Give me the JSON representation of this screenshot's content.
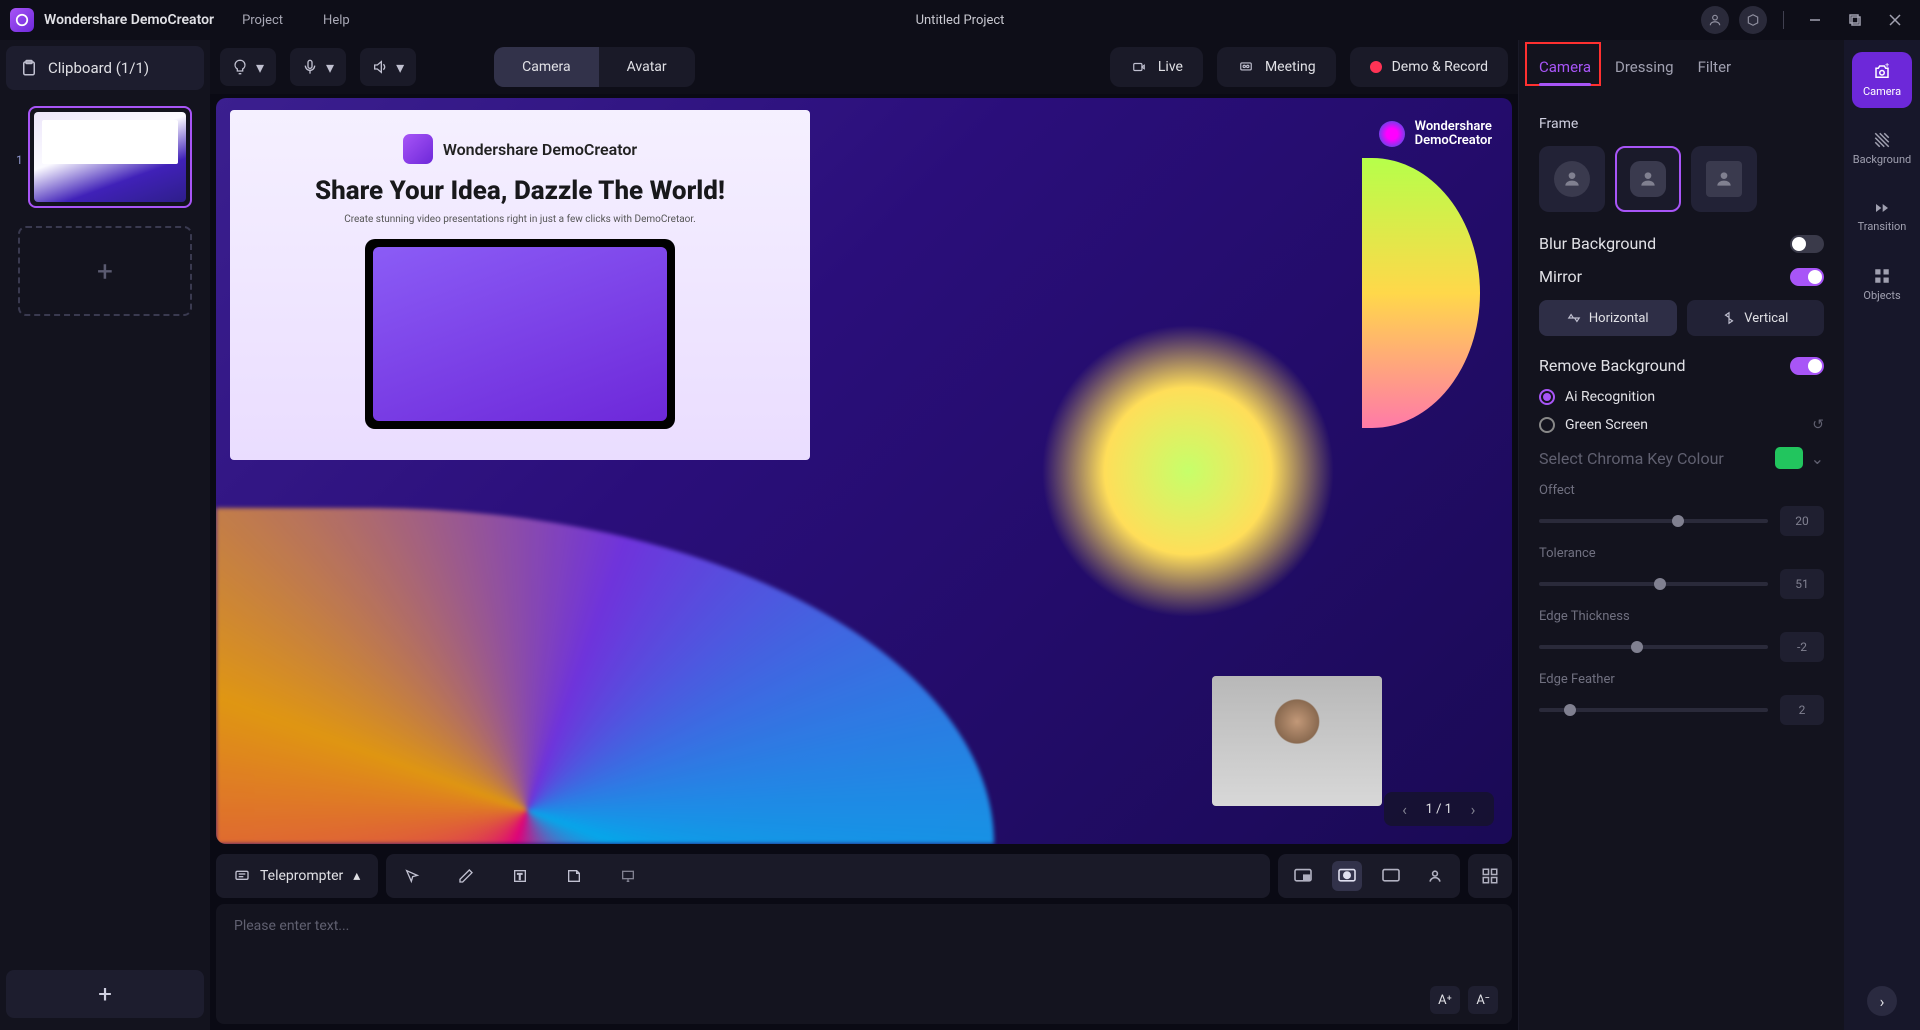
{
  "titlebar": {
    "app_name": "Wondershare DemoCreator",
    "menu": {
      "project": "Project",
      "help": "Help"
    },
    "project_title": "Untitled Project"
  },
  "left": {
    "clipboard_label": "Clipboard (1/1)",
    "slide_index": "1"
  },
  "center_top": {
    "camera_tab": "Camera",
    "avatar_tab": "Avatar",
    "live_btn": "Live",
    "meeting_btn": "Meeting",
    "record_btn": "Demo & Record"
  },
  "canvas": {
    "brand_text": "Wondershare DemoCreator",
    "headline": "Share Your Idea, Dazzle The World!",
    "sub": "Create stunning video presentations right in just a few clicks with DemoCretaor.",
    "watermark1": "Wondershare",
    "watermark2": "DemoCreator",
    "pager": "1 / 1"
  },
  "teleprompter": {
    "label": "Teleprompter",
    "placeholder": "Please enter text...",
    "font_inc": "A⁺",
    "font_dec": "A⁻"
  },
  "right": {
    "tabs": {
      "camera": "Camera",
      "dressing": "Dressing",
      "filter": "Filter"
    },
    "frame_label": "Frame",
    "blur_label": "Blur Background",
    "mirror_label": "Mirror",
    "horizontal": "Horizontal",
    "vertical": "Vertical",
    "remove_bg": "Remove Background",
    "ai_rec": "Ai Recognition",
    "green_screen": "Green Screen",
    "chroma_label": "Select Chroma Key Colour",
    "sliders": {
      "offect": {
        "label": "Offect",
        "value": "20",
        "pos": 58
      },
      "tolerance": {
        "label": "Tolerance",
        "value": "51",
        "pos": 50
      },
      "edge_thickness": {
        "label": "Edge Thickness",
        "value": "-2",
        "pos": 40
      },
      "edge_feather": {
        "label": "Edge Feather",
        "value": "2",
        "pos": 11
      }
    }
  },
  "farright": {
    "camera": "Camera",
    "background": "Background",
    "transition": "Transition",
    "objects": "Objects"
  }
}
